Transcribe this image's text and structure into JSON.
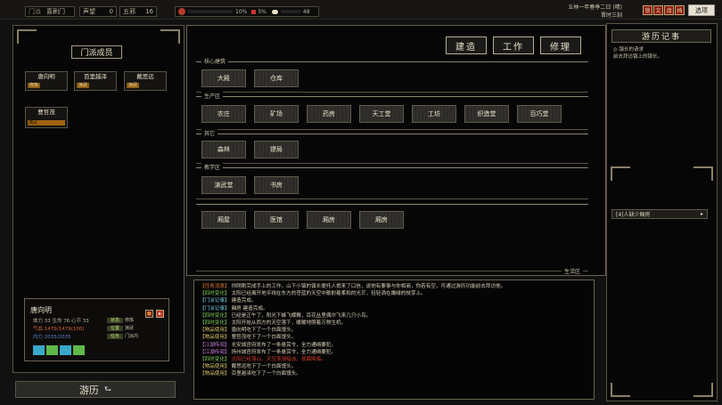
{
  "topbar": {
    "sect_label": "门派",
    "sect_name": "喜刷门",
    "reputation_label": "声望",
    "reputation_value": "0",
    "disciples_label": "五邪",
    "disciples_value": "16",
    "resource_a": "10%",
    "resource_b": "5%",
    "resource_c": "48",
    "date_line1": "五林一年春季二日 (晴)",
    "date_line2": "晋时三刻",
    "icons": [
      "锁",
      "文",
      "战",
      "档"
    ],
    "options_label": "选项"
  },
  "left_panel": {
    "title": "门派成员",
    "members": [
      {
        "name": "唐向明",
        "state": "修炼",
        "style": "tag"
      },
      {
        "name": "百里越泽",
        "state": "演武",
        "style": "tag"
      },
      {
        "name": "戴思远",
        "state": "演武",
        "style": "tag"
      },
      {
        "name": "曹哲茂",
        "state": "演武",
        "style": "bar"
      }
    ],
    "profile": {
      "name": "唐向明",
      "stat_line1": "体力 33  生命 76  心节 33",
      "stat_line2": "气血 1479/1479(100)",
      "stat_line3": "内力 2035/2035",
      "tags": [
        {
          "tag": "状态",
          "text": "修炼"
        },
        {
          "tag": "位置",
          "text": "演武"
        },
        {
          "tag": "任务",
          "text": "门派内"
        }
      ],
      "btn_a": "■",
      "btn_b": "▸"
    },
    "travel_label": "游历"
  },
  "main": {
    "actions": [
      "建造",
      "工作",
      "修理"
    ],
    "sections": [
      {
        "title": "核心建筑",
        "buildings": [
          "大殿",
          "仓库"
        ]
      },
      {
        "title": "生产区",
        "buildings": [
          "农庄",
          "矿场",
          "药房",
          "天工堂",
          "工坊",
          "织造堂",
          "百巧堂"
        ]
      },
      {
        "title": "其它",
        "buildings": [
          "森林",
          "镖局"
        ]
      },
      {
        "title": "教学区",
        "buildings": [
          "演武堂",
          "书房"
        ]
      },
      {
        "title": "生活区",
        "buildings": [
          "厢屋",
          "医馆",
          "厢房",
          "厢房"
        ]
      }
    ]
  },
  "log": [
    {
      "tag": "【任务消息】",
      "text": "你刚刚完成手上的工作，山下小镇的镇长便托人捎来了口信，说他有要事与你相商，你若有空，可通过游历功能前去拜访他。",
      "color": "#e07a36"
    },
    {
      "tag": "【四时变化】",
      "text": "太阳已经离开地平线在东方的苍蓝的天空中散射着柔和的光芒，轻轻洒在嫩绿的枝芽上。",
      "color": "#7fcf5b"
    },
    {
      "tag": "【门派记事】",
      "text": "建造完成。",
      "color": "#6cc6e0"
    },
    {
      "tag": "【门派记事】",
      "text": "厢房 建造完成。",
      "color": "#6cc6e0"
    },
    {
      "tag": "【四时变化】",
      "text": "已经是正午了，阳光下蜂飞蝶舞，百花丛里偶尔飞来几只小鸟。",
      "color": "#7fcf5b"
    },
    {
      "tag": "【四时变化】",
      "text": "太阳开始从西方的天空落下，暖暖地照着万物生机。",
      "color": "#7fcf5b"
    },
    {
      "tag": "【物品使用】",
      "text": "唐向明吃下了一个白面馒头。",
      "color": "#d7c46a"
    },
    {
      "tag": "【物品使用】",
      "text": "曹哲茂吃下了一个白面馒头。",
      "color": "#d7c46a"
    },
    {
      "tag": "【江湖传闻】",
      "text": "长安城官府发布了一条悬赏令，全力通缉要犯。",
      "color": "#c77ad8"
    },
    {
      "tag": "【江湖传闻】",
      "text": "扬州城官府发布了一条悬赏令，全力通缉要犯。",
      "color": "#c77ad8"
    },
    {
      "tag": "【四时变化】",
      "text": "太阳已经落山，天空渐渐暗淡，夜幕降临。",
      "color": "#d23a2a"
    },
    {
      "tag": "【物品使用】",
      "text": "戴思远吃下了一个白面馒头。",
      "color": "#d7c46a"
    },
    {
      "tag": "【物品使用】",
      "text": "百里越泽吃下了一个白面馒头。",
      "color": "#d7c46a"
    }
  ],
  "journal": {
    "title": "游历记事",
    "lines": [
      "◎ 镇长的请求",
      "前去拜访镇上的镇长。"
    ],
    "event": "[4]人缺少厢房"
  },
  "colors": {
    "accent": "#a69a7c",
    "panel_bg": "#060606",
    "button_bg": "#2b2a27"
  }
}
